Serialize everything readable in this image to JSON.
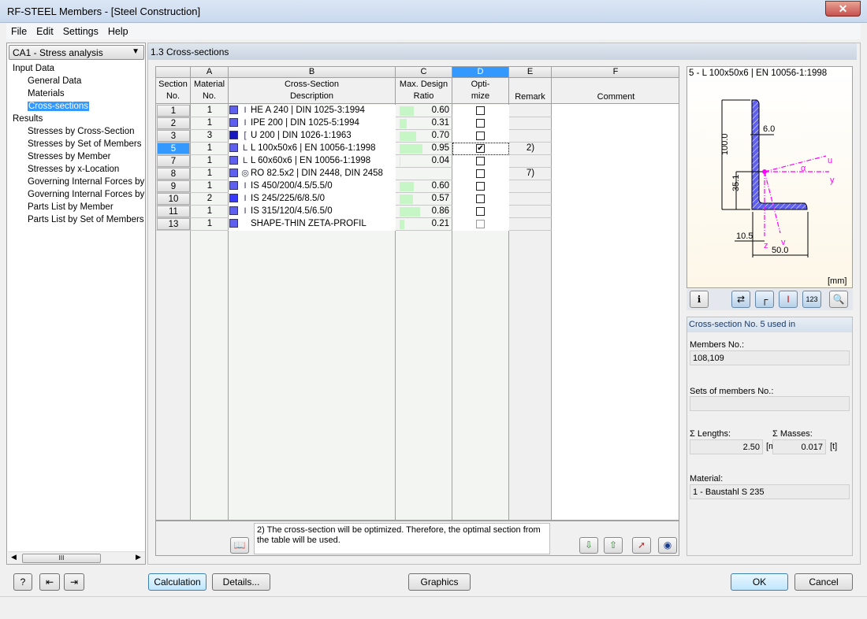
{
  "window": {
    "title": "RF-STEEL Members - [Steel Construction]",
    "close_icon": "close-icon"
  },
  "menu": [
    "File",
    "Edit",
    "Settings",
    "Help"
  ],
  "case_select": {
    "value": "CA1 - Stress analysis"
  },
  "tree": {
    "input_label": "Input Data",
    "input_items": [
      "General Data",
      "Materials",
      "Cross-sections"
    ],
    "results_label": "Results",
    "results_items": [
      "Stresses by Cross-Section",
      "Stresses by Set of Members",
      "Stresses by Member",
      "Stresses by x-Location",
      "Governing Internal Forces by M",
      "Governing Internal Forces by Se",
      "Parts List by Member",
      "Parts List by Set of Members"
    ],
    "selected": "Cross-sections",
    "scroll_thumb": "III"
  },
  "section_header": "1.3 Cross-sections",
  "table": {
    "col_letters": [
      "A",
      "B",
      "C",
      "D",
      "E",
      "F"
    ],
    "headers": {
      "section": [
        "Section",
        "No."
      ],
      "material": [
        "Material",
        "No."
      ],
      "description": [
        "Cross-Section",
        "Description"
      ],
      "ratio": [
        "Max. Design",
        "Ratio"
      ],
      "optimize": [
        "Opti-",
        "mize"
      ],
      "remark": "Remark",
      "comment": "Comment"
    },
    "rows": [
      {
        "no": "1",
        "mat": "1",
        "color": "#6060f0",
        "icon": "I-beam-icon",
        "glyph": "I",
        "desc": "HE A 240 | DIN 1025-3:1994",
        "ratio": 0.6,
        "ratio_text": "0.60",
        "opt": false,
        "remark": ""
      },
      {
        "no": "2",
        "mat": "1",
        "color": "#6060f0",
        "icon": "I-beam-icon",
        "glyph": "I",
        "desc": "IPE 200 | DIN 1025-5:1994",
        "ratio": 0.31,
        "ratio_text": "0.31",
        "opt": false,
        "remark": ""
      },
      {
        "no": "3",
        "mat": "3",
        "color": "#1818c0",
        "icon": "channel-icon",
        "glyph": "[",
        "desc": "U 200 | DIN 1026-1:1963",
        "ratio": 0.7,
        "ratio_text": "0.70",
        "opt": false,
        "remark": ""
      },
      {
        "no": "5",
        "mat": "1",
        "color": "#6060f0",
        "icon": "angle-icon",
        "glyph": "L",
        "desc": "L 100x50x6 | EN 10056-1:1998",
        "ratio": 0.95,
        "ratio_text": "0.95",
        "opt": true,
        "remark": "2)",
        "active": true
      },
      {
        "no": "7",
        "mat": "1",
        "color": "#6060f0",
        "icon": "angle-icon",
        "glyph": "L",
        "desc": "L 60x60x6 | EN 10056-1:1998",
        "ratio": 0.04,
        "ratio_text": "0.04",
        "opt": false,
        "remark": ""
      },
      {
        "no": "8",
        "mat": "1",
        "color": "#6060f0",
        "icon": "pipe-icon",
        "glyph": "◎",
        "desc": "RO 82.5x2 | DIN 2448, DIN 2458",
        "ratio": null,
        "ratio_text": "",
        "opt": false,
        "remark": "7)"
      },
      {
        "no": "9",
        "mat": "1",
        "color": "#6060f0",
        "icon": "I-beam-icon",
        "glyph": "I",
        "desc": "IS 450/200/4.5/5.5/0",
        "ratio": 0.6,
        "ratio_text": "0.60",
        "opt": false,
        "remark": ""
      },
      {
        "no": "10",
        "mat": "2",
        "color": "#3838ff",
        "icon": "I-beam-icon",
        "glyph": "I",
        "desc": "IS 245/225/6/8.5/0",
        "ratio": 0.57,
        "ratio_text": "0.57",
        "opt": false,
        "remark": ""
      },
      {
        "no": "11",
        "mat": "1",
        "color": "#6060f0",
        "icon": "I-beam-icon",
        "glyph": "I",
        "desc": "IS 315/120/4.5/6.5/0",
        "ratio": 0.86,
        "ratio_text": "0.86",
        "opt": false,
        "remark": ""
      },
      {
        "no": "13",
        "mat": "1",
        "color": "#6060f0",
        "icon": "",
        "glyph": "",
        "desc": "SHAPE-THIN ZETA-PROFIL",
        "ratio": 0.21,
        "ratio_text": "0.21",
        "opt": false,
        "remark": "",
        "opt_disabled": true
      }
    ],
    "ratio_bar_color": "#c6f5c6",
    "note": "2) The cross-section will be optimized. Therefore, the optimal section from the table will be used."
  },
  "graphic": {
    "title": "5 - L 100x50x6 | EN 10056-1:1998",
    "unit": "[mm]",
    "dims": {
      "height": "100.0",
      "thickness": "6.0",
      "cy": "35.1",
      "cz": "10.5",
      "width": "50.0"
    },
    "axes": {
      "u": "u",
      "y": "y",
      "z": "z",
      "v": "v",
      "alpha": "α"
    },
    "section_fill": "#6060f0",
    "axis_color": "#ff00ff"
  },
  "info": {
    "header": "Cross-section No. 5 used in",
    "members_label": "Members No.:",
    "members_value": "108,109",
    "sets_label": "Sets of members No.:",
    "sets_value": "",
    "lengths_label": "Σ Lengths:",
    "lengths_value": "2.50",
    "lengths_unit": "[m]",
    "masses_label": "Σ Masses:",
    "masses_value": "0.017",
    "masses_unit": "[t]",
    "material_label": "Material:",
    "material_value": "1 - Baustahl S 235"
  },
  "buttons": {
    "calculation": "Calculation",
    "details": "Details...",
    "graphics": "Graphics",
    "ok": "OK",
    "cancel": "Cancel"
  }
}
